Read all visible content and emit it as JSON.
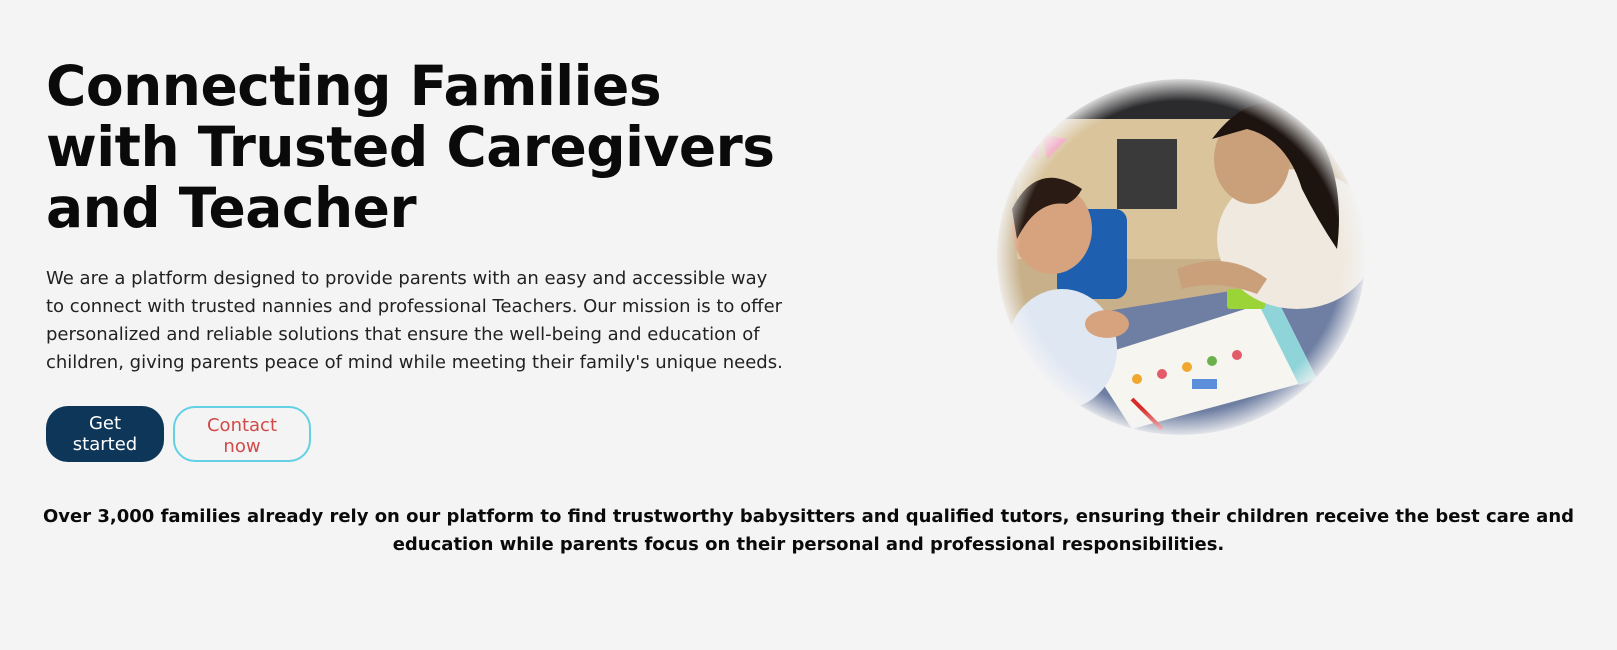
{
  "hero": {
    "title": "Connecting Families with Trusted Caregivers and Teacher",
    "description": "We are a platform designed to provide parents with an easy and accessible way to connect with trusted nannies and professional Teachers. Our mission is to offer personalized and reliable solutions that ensure the well-being and education of children, giving parents peace of mind while meeting their family's unique needs.",
    "primary_button": "Get started",
    "secondary_button": "Contact now"
  },
  "stats": {
    "text": "Over 3,000 families already rely on our platform to find trustworthy babysitters and qualified tutors, ensuring their children receive the best care and education while parents focus on their personal and professional responsibilities."
  },
  "colors": {
    "background": "#f4f4f4",
    "primary_button_bg": "#0e3658",
    "secondary_button_text": "#d14a48",
    "secondary_button_border": "#63d0e4"
  }
}
